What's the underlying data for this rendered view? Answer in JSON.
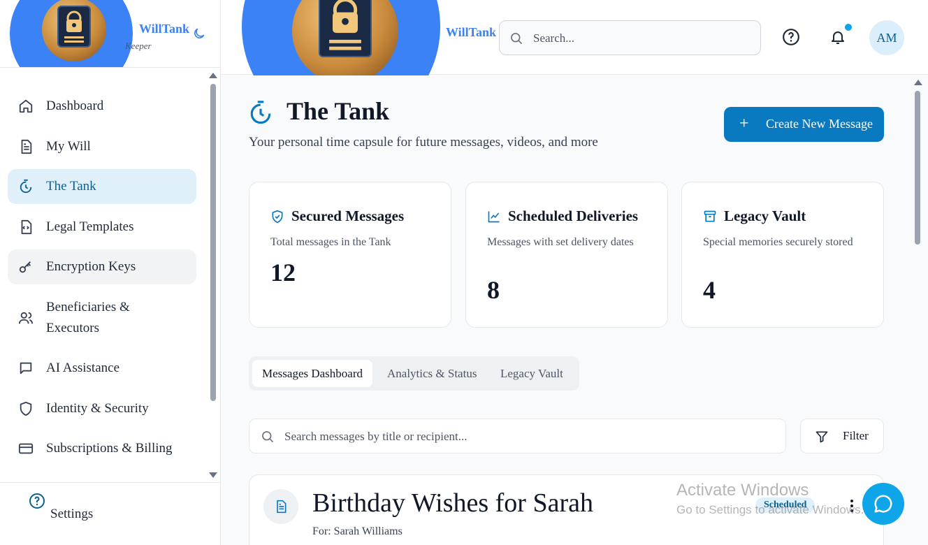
{
  "app": {
    "brand_name": "WillTank",
    "brand_tagline": "Keeper"
  },
  "sidebar": {
    "items": [
      {
        "label": "Dashboard",
        "icon": "home-icon"
      },
      {
        "label": "My Will",
        "icon": "document-icon"
      },
      {
        "label": "The Tank",
        "icon": "timer-icon",
        "active": true
      },
      {
        "label": "Legal Templates",
        "icon": "code-file-icon"
      },
      {
        "label": "Encryption Keys",
        "icon": "key-icon",
        "hover": true
      },
      {
        "label": "Beneficiaries & Executors",
        "icon": "users-icon"
      },
      {
        "label": "AI Assistance",
        "icon": "chat-icon"
      },
      {
        "label": "Identity & Security",
        "icon": "shield-icon"
      },
      {
        "label": "Subscriptions & Billing",
        "icon": "credit-card-icon"
      }
    ],
    "settings_label": "Settings"
  },
  "topbar": {
    "brand_name": "WillTank",
    "search_placeholder": "Search...",
    "avatar_initials": "AM"
  },
  "main": {
    "title": "The Tank",
    "subtitle": "Your personal time capsule for future messages, videos, and more",
    "create_button": "Create New Message",
    "stats": [
      {
        "title": "Secured Messages",
        "description": "Total messages in the Tank",
        "value": "12",
        "icon": "shield-check-icon"
      },
      {
        "title": "Scheduled Deliveries",
        "description": "Messages with set delivery dates",
        "value": "8",
        "icon": "line-chart-icon"
      },
      {
        "title": "Legacy Vault",
        "description": "Special memories securely stored",
        "value": "4",
        "icon": "archive-icon"
      }
    ],
    "tabs": [
      "Messages Dashboard",
      "Analytics & Status",
      "Legacy Vault"
    ],
    "message_search_placeholder": "Search messages by title or recipient...",
    "filter_label": "Filter",
    "messages": [
      {
        "title": "Birthday Wishes for Sarah",
        "recipient": "For: Sarah Williams",
        "status": "Scheduled"
      }
    ]
  },
  "overlay": {
    "watermark_title": "Activate Windows",
    "watermark_sub": "Go to Settings to activate Windows."
  },
  "colors": {
    "accent": "#0a7ac0",
    "brand_blue": "#3b82f6",
    "active_bg": "#e0f0fb"
  }
}
